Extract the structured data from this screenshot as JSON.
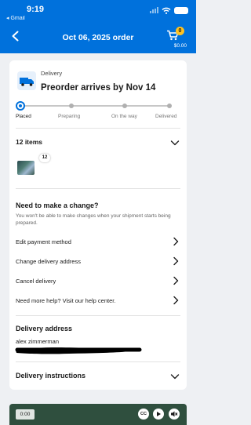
{
  "status_bar": {
    "time": "9:19",
    "back_app": "◂ Gmail"
  },
  "header": {
    "title": "Oct 06, 2025 order",
    "cart_count": "0",
    "cart_total": "$0.00"
  },
  "delivery": {
    "label": "Delivery",
    "title": "Preorder arrives by Nov 14"
  },
  "tracking": {
    "stages": [
      {
        "label": "Placed"
      },
      {
        "label": "Preparing"
      },
      {
        "label": "On the way"
      },
      {
        "label": "Delivered"
      }
    ],
    "progress_fraction": 0
  },
  "items": {
    "count_label": "12 items",
    "thumb_badge": "12"
  },
  "change": {
    "title": "Need to make a change?",
    "description": "You won't be able to make changes when your shipment starts being prepared.",
    "actions": [
      {
        "label": "Edit payment method"
      },
      {
        "label": "Change delivery address"
      },
      {
        "label": "Cancel delivery"
      },
      {
        "label": "Need more help? Visit our help center."
      }
    ]
  },
  "address": {
    "title": "Delivery address",
    "name": "alex zimmerman"
  },
  "instructions": {
    "title": "Delivery instructions"
  },
  "video": {
    "time": "0:00",
    "cc_label": "CC"
  },
  "colors": {
    "brand_blue": "#0071dc",
    "cart_badge": "#ffc220",
    "video_bg": "#2f4f3e"
  }
}
